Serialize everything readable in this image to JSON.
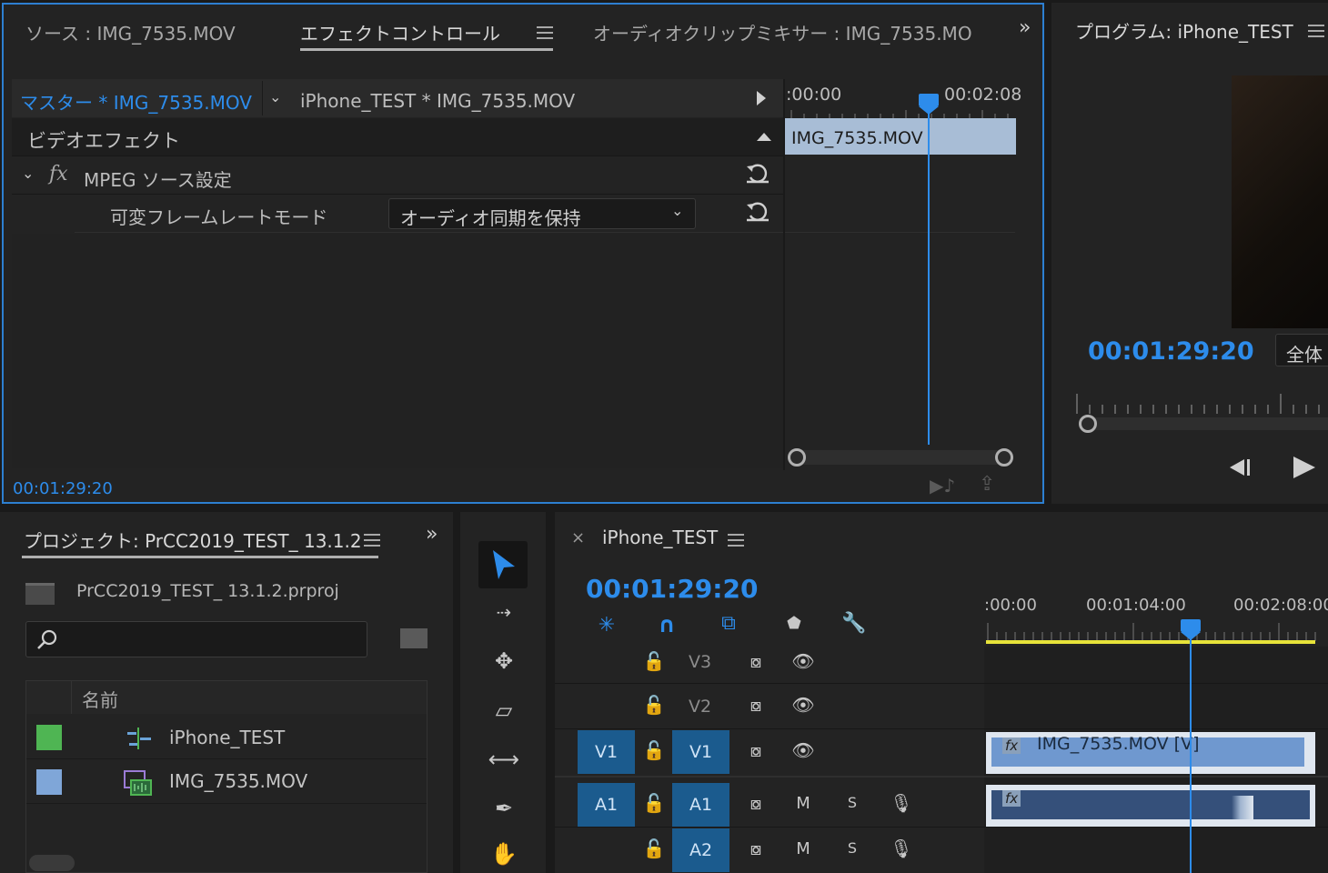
{
  "source_panel": {
    "tabs": [
      "ソース : IMG_7535.MOV",
      "エフェクトコントロール",
      "オーディオクリップミキサー : IMG_7535.MO"
    ],
    "active_tab": 1,
    "master_label": "マスター * IMG_7535.MOV",
    "sequence_clip_label": "iPhone_TEST * IMG_7535.MOV",
    "video_effects_header": "ビデオエフェクト",
    "fx_symbol": "fx",
    "effect_name": "MPEG ソース設定",
    "param_label": "可変フレームレートモード",
    "param_value": "オーディオ同期を保持",
    "mini_timeline": {
      "start_tc": ":00:00",
      "end_tc": "00:02:08",
      "clip_name": "IMG_7535.MOV"
    },
    "timecode": "00:01:29:20"
  },
  "program_monitor": {
    "title": "プログラム: iPhone_TEST",
    "timecode": "00:01:29:20",
    "fit_label": "全体"
  },
  "project_panel": {
    "title": "プロジェクト: PrCC2019_TEST_ 13.1.2",
    "file_name": "PrCC2019_TEST_ 13.1.2.prproj",
    "search_placeholder": "",
    "column_name": "名前",
    "items": [
      {
        "name": "iPhone_TEST",
        "color": "#4fb553",
        "icon": "sequence-icon"
      },
      {
        "name": "IMG_7535.MOV",
        "color": "#7fa6d8",
        "icon": "clip-icon"
      }
    ]
  },
  "timeline": {
    "sequence_name": "iPhone_TEST",
    "timecode": "00:01:29:20",
    "ruler": [
      ":00:00",
      "00:01:04:00",
      "00:02:08:00"
    ],
    "tracks": [
      {
        "target": "",
        "name": "V3",
        "type": "video"
      },
      {
        "target": "",
        "name": "V2",
        "type": "video"
      },
      {
        "target": "V1",
        "name": "V1",
        "type": "video"
      },
      {
        "target": "A1",
        "name": "A1",
        "type": "audio",
        "mute": "M",
        "solo": "S"
      },
      {
        "target": "",
        "name": "A2",
        "type": "audio",
        "mute": "M",
        "solo": "S"
      }
    ],
    "video_clip_label": "IMG_7535.MOV [V]",
    "fx_badge": "fx"
  },
  "colors": {
    "accent_blue": "#2d8ceb",
    "panel_bg": "#232323",
    "video_clip": "#6f98cf",
    "audio_clip": "#35507a",
    "work_area": "#e7e33a"
  }
}
